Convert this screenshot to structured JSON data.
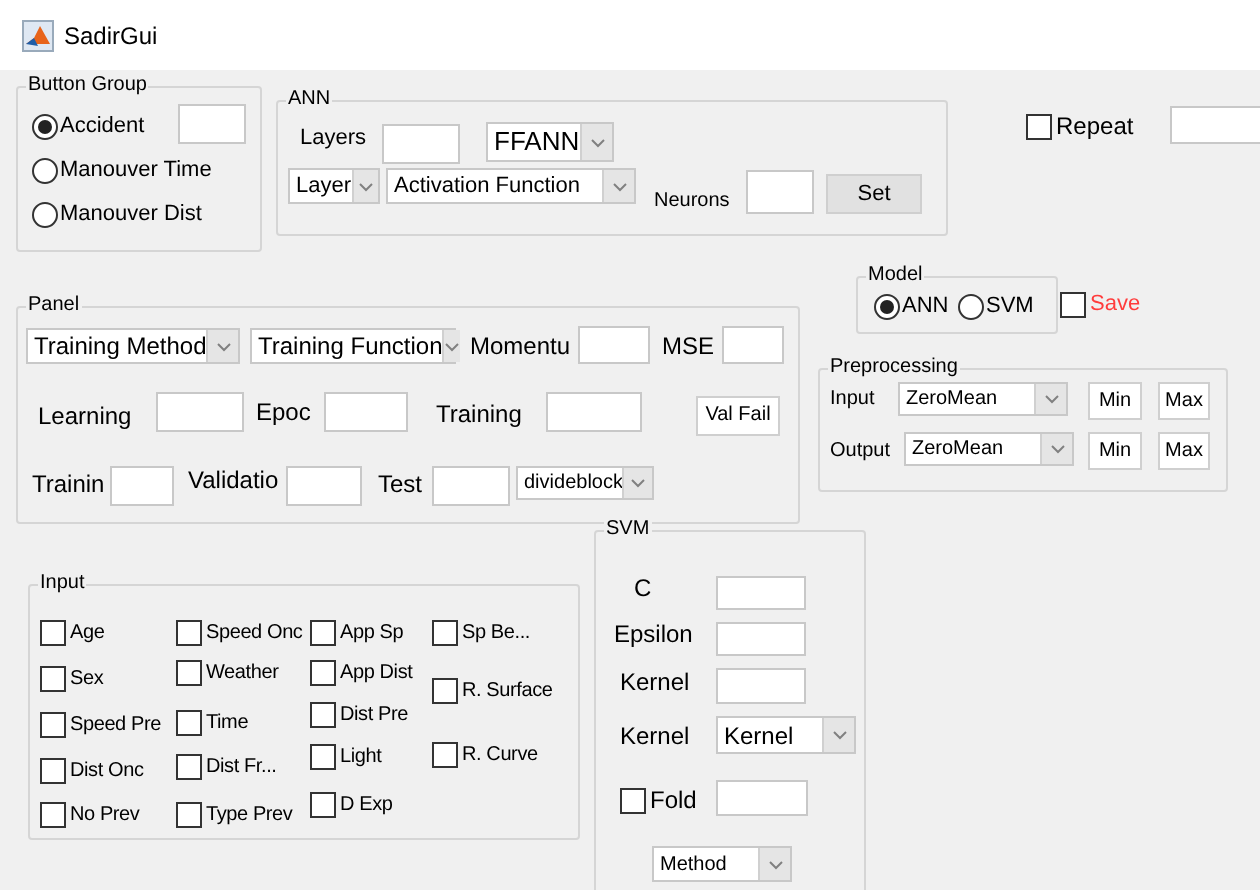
{
  "window": {
    "title": "SadirGui"
  },
  "button_group": {
    "title": "Button Group",
    "options": [
      {
        "label": "Accident",
        "selected": true
      },
      {
        "label": "Manouver Time",
        "selected": false
      },
      {
        "label": "Manouver Dist",
        "selected": false
      }
    ]
  },
  "ann": {
    "title": "ANN",
    "layers_label": "Layers",
    "network": "FFANN",
    "layer": "Layer",
    "activation": "Activation Function",
    "neurons_label": "Neurons",
    "set_button": "Set"
  },
  "repeat": {
    "label": "Repeat",
    "checked": false
  },
  "model": {
    "title": "Model",
    "options": [
      {
        "label": "ANN",
        "selected": true
      },
      {
        "label": "SVM",
        "selected": false
      }
    ]
  },
  "save": {
    "label": "Save",
    "checked": false
  },
  "preprocessing": {
    "title": "Preprocessing",
    "rows": [
      {
        "label": "Input",
        "method": "ZeroMean",
        "min": "Min",
        "max": "Max"
      },
      {
        "label": "Output",
        "method": "ZeroMean",
        "min": "Min",
        "max": "Max"
      }
    ]
  },
  "panel": {
    "title": "Panel",
    "training_method": "Training Method",
    "training_function": "Training Function",
    "momentum_label": "Momentu",
    "mse_label": "MSE",
    "learning_label": "Learning",
    "epoch_label": "Epoc",
    "training_label": "Training",
    "val_fail_button": "Val Fail",
    "train_label": "Trainin",
    "validation_label": "Validatio",
    "test_label": "Test",
    "divide": "divideblock"
  },
  "input": {
    "title": "Input",
    "columns": [
      [
        {
          "label": "Age",
          "checked": false
        },
        {
          "label": "Sex",
          "checked": false
        },
        {
          "label": "Speed Pre",
          "checked": false
        },
        {
          "label": "Dist Onc",
          "checked": false
        },
        {
          "label": "No Prev",
          "checked": false
        }
      ],
      [
        {
          "label": "Speed Onc",
          "checked": false
        },
        {
          "label": "Weather",
          "checked": false
        },
        {
          "label": "Time",
          "checked": false
        },
        {
          "label": "Dist Fr...",
          "checked": false
        },
        {
          "label": "Type Prev",
          "checked": false
        }
      ],
      [
        {
          "label": "App Sp",
          "checked": false
        },
        {
          "label": "App Dist",
          "checked": false
        },
        {
          "label": "Dist Pre",
          "checked": false
        },
        {
          "label": "Light",
          "checked": false
        },
        {
          "label": "D Exp",
          "checked": false
        }
      ],
      [
        {
          "label": "Sp Be...",
          "checked": false
        },
        {
          "label": "R. Surface",
          "checked": false
        },
        {
          "label": "R. Curve",
          "checked": false
        }
      ]
    ]
  },
  "svm": {
    "title": "SVM",
    "c_label": "C",
    "epsilon_label": "Epsilon",
    "kernel_label": "Kernel",
    "kernel_type_label": "Kernel",
    "kernel": "Kernel",
    "fold": {
      "label": "Fold",
      "checked": false
    },
    "method": "Method"
  }
}
